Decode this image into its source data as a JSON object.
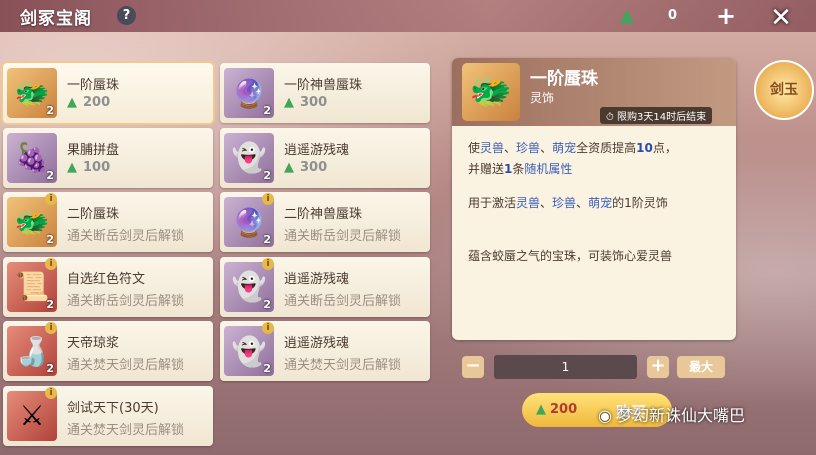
{
  "header": {
    "title": "剑冢宝阁",
    "help": "?",
    "currency_value": "0",
    "plus": "+",
    "close": "✕"
  },
  "items": [
    {
      "name": "一阶蜃珠",
      "price": "200",
      "qty": "2",
      "locked": false,
      "icon": "dragon-pearl-icon"
    },
    {
      "name": "一阶神兽蜃珠",
      "price": "300",
      "qty": "2",
      "locked": false,
      "icon": "beast-pearl-icon"
    },
    {
      "name": "果脯拼盘",
      "price": "100",
      "qty": "2",
      "locked": false,
      "icon": "fruit-plate-icon"
    },
    {
      "name": "逍遥游残魂",
      "price": "300",
      "qty": "2",
      "locked": false,
      "icon": "soul-fragment-icon"
    },
    {
      "name": "二阶蜃珠",
      "unlock": "通关断岳剑灵后解锁",
      "qty": "2",
      "locked": true,
      "icon": "dragon-pearl-icon"
    },
    {
      "name": "二阶神兽蜃珠",
      "unlock": "通关断岳剑灵后解锁",
      "qty": "2",
      "locked": true,
      "icon": "beast-pearl-icon"
    },
    {
      "name": "自选红色符文",
      "unlock": "通关断岳剑灵后解锁",
      "qty": "2",
      "locked": true,
      "icon": "rune-icon"
    },
    {
      "name": "逍遥游残魂",
      "unlock": "通关断岳剑灵后解锁",
      "qty": "2",
      "locked": true,
      "icon": "soul-fragment-icon"
    },
    {
      "name": "天帝琼浆",
      "unlock": "通关焚天剑灵后解锁",
      "qty": "2",
      "locked": true,
      "icon": "gourd-icon"
    },
    {
      "name": "逍遥游残魂",
      "unlock": "通关焚天剑灵后解锁",
      "qty": "2",
      "locked": true,
      "icon": "soul-fragment-icon"
    },
    {
      "name": "剑试天下(30天)",
      "unlock": "通关焚天剑灵后解锁",
      "qty": "",
      "locked": true,
      "icon": "sword-icon"
    }
  ],
  "detail": {
    "name": "一阶蜃珠",
    "type": "灵饰",
    "limit": "限购3天14时后结束",
    "line1_a": "使",
    "line1_b": "灵兽",
    "line1_c": "、",
    "line1_d": "珍兽",
    "line1_e": "、",
    "line1_f": "萌宠",
    "line1_g": "全资质提高",
    "line1_h": "10",
    "line1_i": "点，",
    "line2_a": "并赠送",
    "line2_b": "1",
    "line2_c": "条",
    "line2_d": "随机属性",
    "line3_a": "用于激活",
    "line3_b": "灵兽",
    "line3_c": "、",
    "line3_d": "珍兽",
    "line3_e": "、",
    "line3_f": "萌宠",
    "line3_g": "的1阶灵饰",
    "flavor": "蕴含蛟蜃之气的宝珠，可装饰心爱灵兽"
  },
  "purchase": {
    "minus": "−",
    "quantity": "1",
    "plus": "+",
    "max": "最大",
    "price": "200",
    "buy": "购买"
  },
  "side_badge": {
    "text": "剑玉"
  },
  "watermark": "梦幻新诛仙大嘴巴"
}
